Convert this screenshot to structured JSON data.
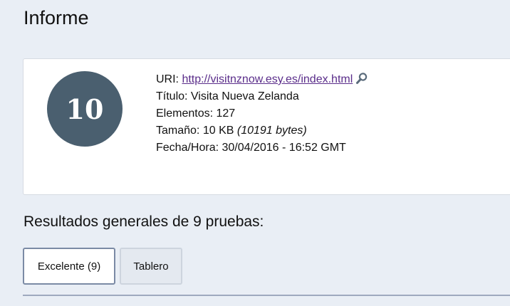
{
  "page": {
    "title": "Informe"
  },
  "summary": {
    "score": "10",
    "uri_label": "URI:",
    "uri_value": "http://visitnznow.esy.es/index.html",
    "title_label": "Título:",
    "title_value": "Visita Nueva Zelanda",
    "elements_label": "Elementos:",
    "elements_value": "127",
    "size_label": "Tamaño:",
    "size_value": "10 KB",
    "size_bytes": "(10191 bytes)",
    "date_label": "Fecha/Hora:",
    "date_value": "30/04/2016 - 16:52 GMT"
  },
  "results": {
    "heading": "Resultados generales de 9 pruebas:",
    "tabs": [
      {
        "label": "Excelente (9)",
        "active": true
      },
      {
        "label": "Tablero",
        "active": false
      }
    ]
  },
  "icons": {
    "uri_action": "search-icon"
  },
  "colors": {
    "score_circle": "#4a5f6f",
    "link": "#5a2d8a",
    "background": "#e9eef5"
  }
}
